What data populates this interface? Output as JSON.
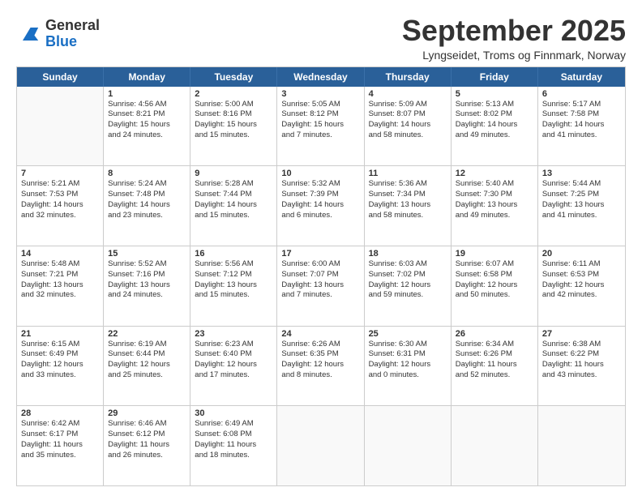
{
  "logo": {
    "general": "General",
    "blue": "Blue"
  },
  "header": {
    "month": "September 2025",
    "location": "Lyngseidet, Troms og Finnmark, Norway"
  },
  "days_of_week": [
    "Sunday",
    "Monday",
    "Tuesday",
    "Wednesday",
    "Thursday",
    "Friday",
    "Saturday"
  ],
  "weeks": [
    [
      {
        "day": "",
        "info": ""
      },
      {
        "day": "1",
        "info": "Sunrise: 4:56 AM\nSunset: 8:21 PM\nDaylight: 15 hours\nand 24 minutes."
      },
      {
        "day": "2",
        "info": "Sunrise: 5:00 AM\nSunset: 8:16 PM\nDaylight: 15 hours\nand 15 minutes."
      },
      {
        "day": "3",
        "info": "Sunrise: 5:05 AM\nSunset: 8:12 PM\nDaylight: 15 hours\nand 7 minutes."
      },
      {
        "day": "4",
        "info": "Sunrise: 5:09 AM\nSunset: 8:07 PM\nDaylight: 14 hours\nand 58 minutes."
      },
      {
        "day": "5",
        "info": "Sunrise: 5:13 AM\nSunset: 8:02 PM\nDaylight: 14 hours\nand 49 minutes."
      },
      {
        "day": "6",
        "info": "Sunrise: 5:17 AM\nSunset: 7:58 PM\nDaylight: 14 hours\nand 41 minutes."
      }
    ],
    [
      {
        "day": "7",
        "info": "Sunrise: 5:21 AM\nSunset: 7:53 PM\nDaylight: 14 hours\nand 32 minutes."
      },
      {
        "day": "8",
        "info": "Sunrise: 5:24 AM\nSunset: 7:48 PM\nDaylight: 14 hours\nand 23 minutes."
      },
      {
        "day": "9",
        "info": "Sunrise: 5:28 AM\nSunset: 7:44 PM\nDaylight: 14 hours\nand 15 minutes."
      },
      {
        "day": "10",
        "info": "Sunrise: 5:32 AM\nSunset: 7:39 PM\nDaylight: 14 hours\nand 6 minutes."
      },
      {
        "day": "11",
        "info": "Sunrise: 5:36 AM\nSunset: 7:34 PM\nDaylight: 13 hours\nand 58 minutes."
      },
      {
        "day": "12",
        "info": "Sunrise: 5:40 AM\nSunset: 7:30 PM\nDaylight: 13 hours\nand 49 minutes."
      },
      {
        "day": "13",
        "info": "Sunrise: 5:44 AM\nSunset: 7:25 PM\nDaylight: 13 hours\nand 41 minutes."
      }
    ],
    [
      {
        "day": "14",
        "info": "Sunrise: 5:48 AM\nSunset: 7:21 PM\nDaylight: 13 hours\nand 32 minutes."
      },
      {
        "day": "15",
        "info": "Sunrise: 5:52 AM\nSunset: 7:16 PM\nDaylight: 13 hours\nand 24 minutes."
      },
      {
        "day": "16",
        "info": "Sunrise: 5:56 AM\nSunset: 7:12 PM\nDaylight: 13 hours\nand 15 minutes."
      },
      {
        "day": "17",
        "info": "Sunrise: 6:00 AM\nSunset: 7:07 PM\nDaylight: 13 hours\nand 7 minutes."
      },
      {
        "day": "18",
        "info": "Sunrise: 6:03 AM\nSunset: 7:02 PM\nDaylight: 12 hours\nand 59 minutes."
      },
      {
        "day": "19",
        "info": "Sunrise: 6:07 AM\nSunset: 6:58 PM\nDaylight: 12 hours\nand 50 minutes."
      },
      {
        "day": "20",
        "info": "Sunrise: 6:11 AM\nSunset: 6:53 PM\nDaylight: 12 hours\nand 42 minutes."
      }
    ],
    [
      {
        "day": "21",
        "info": "Sunrise: 6:15 AM\nSunset: 6:49 PM\nDaylight: 12 hours\nand 33 minutes."
      },
      {
        "day": "22",
        "info": "Sunrise: 6:19 AM\nSunset: 6:44 PM\nDaylight: 12 hours\nand 25 minutes."
      },
      {
        "day": "23",
        "info": "Sunrise: 6:23 AM\nSunset: 6:40 PM\nDaylight: 12 hours\nand 17 minutes."
      },
      {
        "day": "24",
        "info": "Sunrise: 6:26 AM\nSunset: 6:35 PM\nDaylight: 12 hours\nand 8 minutes."
      },
      {
        "day": "25",
        "info": "Sunrise: 6:30 AM\nSunset: 6:31 PM\nDaylight: 12 hours\nand 0 minutes."
      },
      {
        "day": "26",
        "info": "Sunrise: 6:34 AM\nSunset: 6:26 PM\nDaylight: 11 hours\nand 52 minutes."
      },
      {
        "day": "27",
        "info": "Sunrise: 6:38 AM\nSunset: 6:22 PM\nDaylight: 11 hours\nand 43 minutes."
      }
    ],
    [
      {
        "day": "28",
        "info": "Sunrise: 6:42 AM\nSunset: 6:17 PM\nDaylight: 11 hours\nand 35 minutes."
      },
      {
        "day": "29",
        "info": "Sunrise: 6:46 AM\nSunset: 6:12 PM\nDaylight: 11 hours\nand 26 minutes."
      },
      {
        "day": "30",
        "info": "Sunrise: 6:49 AM\nSunset: 6:08 PM\nDaylight: 11 hours\nand 18 minutes."
      },
      {
        "day": "",
        "info": ""
      },
      {
        "day": "",
        "info": ""
      },
      {
        "day": "",
        "info": ""
      },
      {
        "day": "",
        "info": ""
      }
    ]
  ]
}
